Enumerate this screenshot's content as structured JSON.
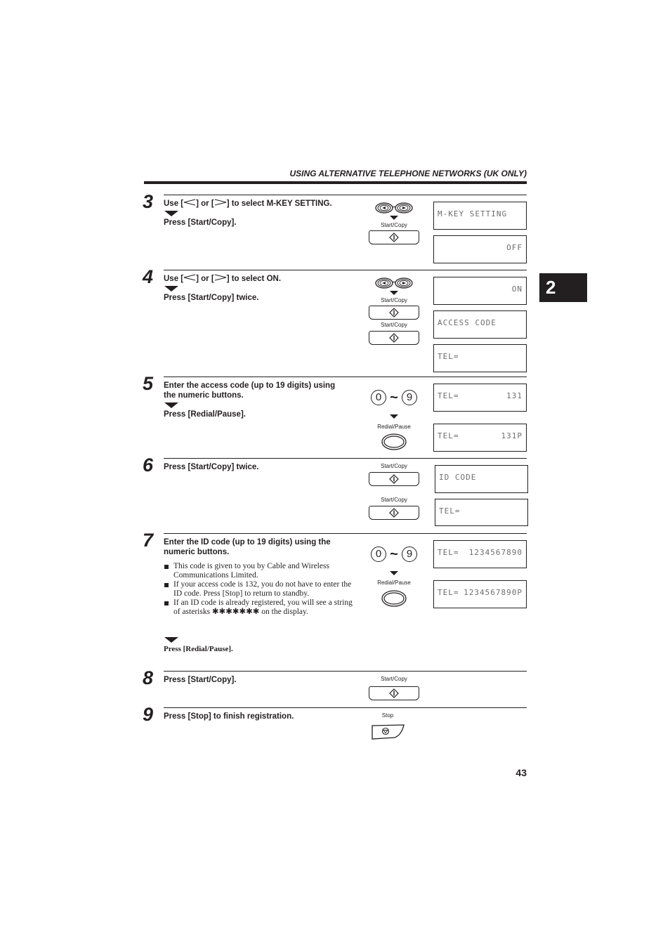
{
  "header": {
    "title": "USING ALTERNATIVE TELEPHONE NETWORKS (UK ONLY)"
  },
  "chapter_tab": "2",
  "page_number": "43",
  "labels": {
    "start_copy": "Start/Copy",
    "redial_pause": "Redial/Pause",
    "stop": "Stop",
    "num_from": "0",
    "num_to": "9",
    "tilde": "~"
  },
  "steps": [
    {
      "number": "3",
      "line1_pre": "Use [",
      "line1_mid": "] or [",
      "line1_post": "] to select M-KEY SETTING.",
      "line2": "Press [Start/Copy].",
      "displays": [
        {
          "left": "M-KEY SETTING",
          "right": ""
        },
        {
          "left": "",
          "right": "OFF"
        }
      ]
    },
    {
      "number": "4",
      "line1_pre": "Use [",
      "line1_mid": "] or [",
      "line1_post": "] to select ON.",
      "line2": "Press [Start/Copy] twice.",
      "displays": [
        {
          "left": "",
          "right": "ON"
        },
        {
          "left": "ACCESS CODE",
          "right": ""
        },
        {
          "left": "TEL=",
          "right": ""
        }
      ]
    },
    {
      "number": "5",
      "line1": "Enter the access code (up to 19 digits) using",
      "line1b": "the numeric buttons.",
      "line2": "Press [Redial/Pause].",
      "displays": [
        {
          "left": "TEL=",
          "right": "131"
        },
        {
          "left": "TEL=",
          "right": "131P"
        }
      ]
    },
    {
      "number": "6",
      "line1": "Press [Start/Copy] twice.",
      "displays": [
        {
          "left": "ID CODE",
          "right": ""
        },
        {
          "left": "TEL=",
          "right": ""
        }
      ]
    },
    {
      "number": "7",
      "line1": "Enter the ID code (up to 19 digits) using the",
      "line1b": "numeric buttons.",
      "bullets": [
        "This code is given to you by Cable and Wireless Communications Limited.",
        "If your access code is 132, you do not have to enter the ID code. Press [Stop] to return to standby.",
        "If an ID code is already registered, you will see a string of asterisks ✱✱✱✱✱✱✱ on the display."
      ],
      "line2": "Press [Redial/Pause].",
      "displays": [
        {
          "left": "TEL=",
          "right": "1234567890"
        },
        {
          "left": "TEL=",
          "right": "1234567890P"
        }
      ]
    },
    {
      "number": "8",
      "line1": "Press [Start/Copy]."
    },
    {
      "number": "9",
      "line1": "Press [Stop] to finish registration."
    }
  ]
}
